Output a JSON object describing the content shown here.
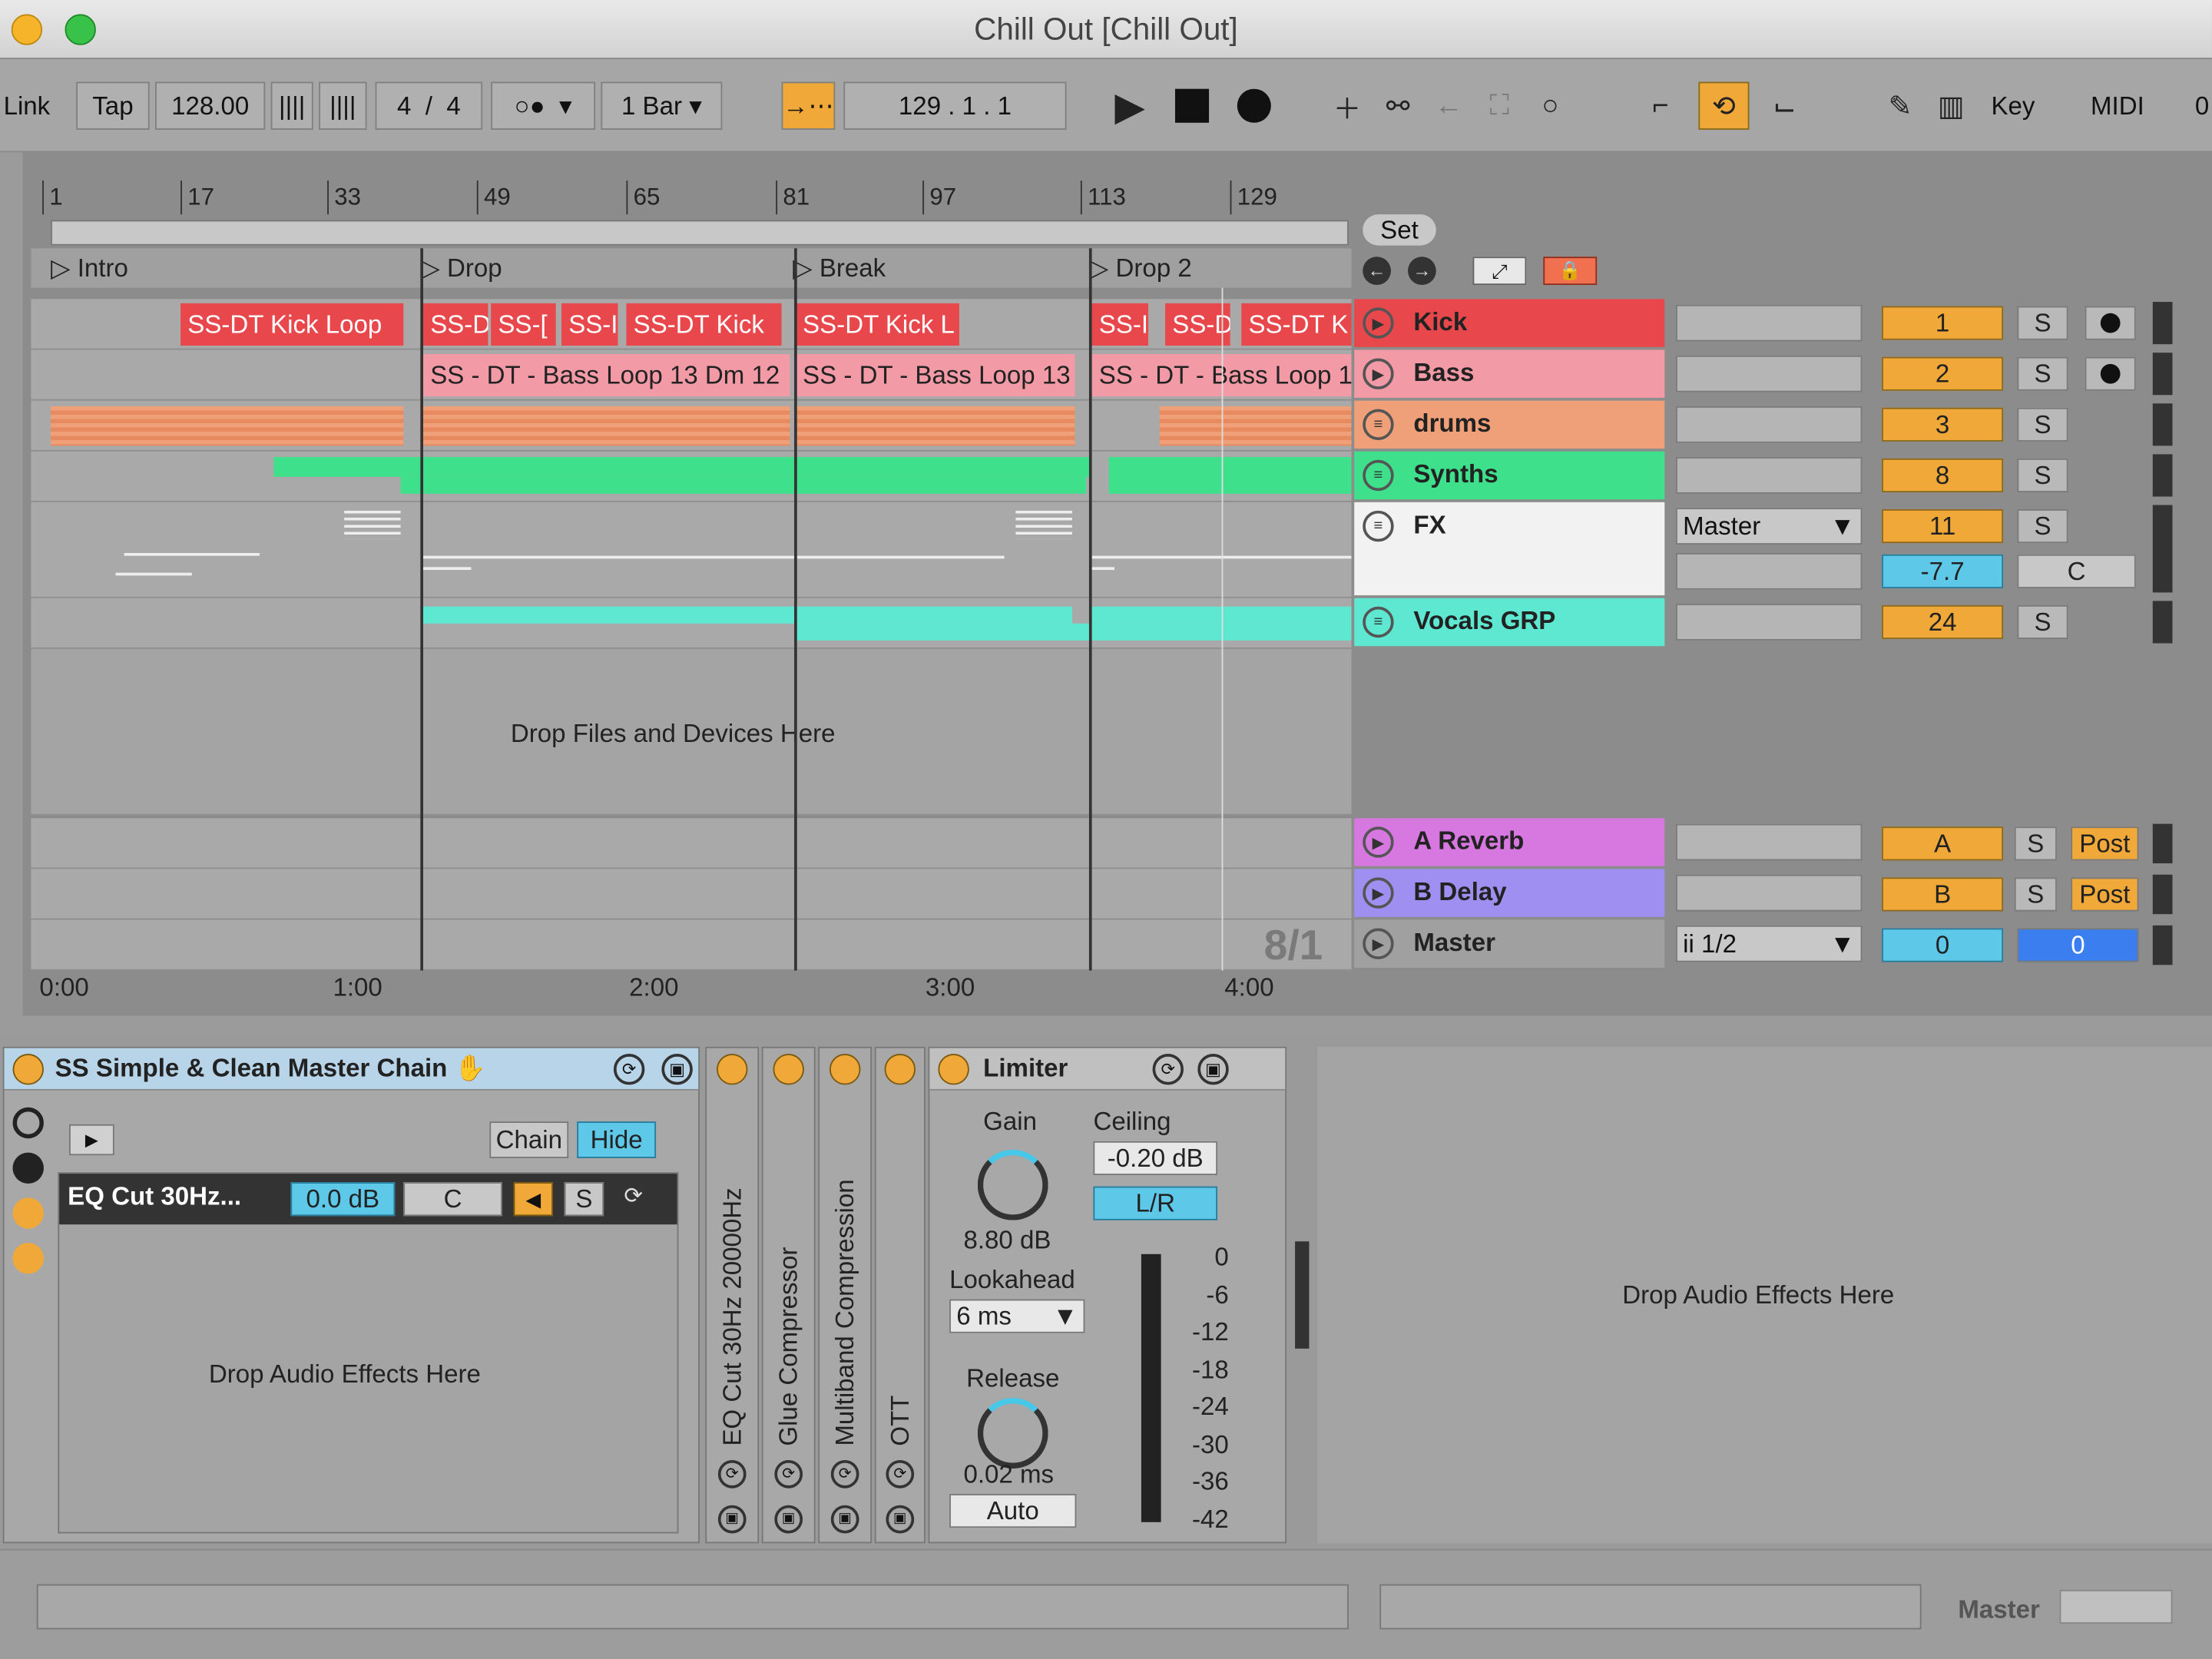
{
  "window": {
    "title": "Chill Out  [Chill Out]"
  },
  "control_bar": {
    "link": "Link",
    "tap": "Tap",
    "tempo": "128.00",
    "signature_num": "4",
    "signature_sep": "/",
    "signature_den": "4",
    "quantize": "1 Bar",
    "position": "129 .   1 .   1",
    "key": "Key",
    "midi": "MIDI",
    "cpu": "0"
  },
  "arrangement": {
    "ruler_bars": [
      "1",
      "17",
      "33",
      "49",
      "65",
      "81",
      "97",
      "113",
      "129"
    ],
    "set_label": "Set",
    "locators": [
      "Intro",
      "Drop",
      "Break",
      "Drop 2"
    ],
    "drop_hint": "Drop Files and Devices Here",
    "zoom_label": "8/1",
    "time_labels": [
      "0:00",
      "1:00",
      "2:00",
      "3:00",
      "4:00"
    ],
    "kick_clips": [
      "SS-DT Kick Loop",
      "SS-D",
      "SS-[",
      "SS-I",
      "SS-DT Kick",
      "SS-DT Kick L",
      "SS-I",
      "SS-D",
      "SS-DT K"
    ],
    "bass_clips": [
      "SS - DT - Bass Loop 13 Dm 12",
      "SS - DT - Bass Loop 13",
      "SS - DT - Bass Loop 1"
    ]
  },
  "tracks": [
    {
      "name": "Kick",
      "number": "1",
      "solo": "S",
      "color": "#e8474b"
    },
    {
      "name": "Bass",
      "number": "2",
      "solo": "S",
      "color": "#f29aa6"
    },
    {
      "name": "drums",
      "number": "3",
      "solo": "S",
      "color": "#f0a078"
    },
    {
      "name": "Synths",
      "number": "8",
      "solo": "S",
      "color": "#3fe08c"
    },
    {
      "name": "FX",
      "number": "11",
      "solo": "S",
      "routing": "Master",
      "volume": "-7.7",
      "pan": "C",
      "color": "#f2f2f2"
    },
    {
      "name": "Vocals GRP",
      "number": "24",
      "solo": "S",
      "color": "#5ee8d2"
    }
  ],
  "returns": [
    {
      "name": "A Reverb",
      "letter": "A",
      "solo": "S",
      "post": "Post",
      "color": "#d777e0"
    },
    {
      "name": "B Delay",
      "letter": "B",
      "solo": "S",
      "post": "Post",
      "color": "#9f8ff0"
    }
  ],
  "master": {
    "name": "Master",
    "routing": "ii 1/2",
    "volume": "0",
    "pan": "0"
  },
  "device_chain": {
    "rack_name": "SS Simple & Clean Master Chain",
    "chain_btn": "Chain",
    "hide_btn": "Hide",
    "chain_item": "EQ Cut 30Hz...",
    "chain_vol": "0.0 dB",
    "chain_pan": "C",
    "chain_solo": "S",
    "drop_hint": "Drop Audio Effects Here",
    "folded": [
      "EQ Cut 30Hz 20000Hz",
      "Glue Compressor",
      "Multiband Compression",
      "OTT"
    ],
    "limiter": {
      "name": "Limiter",
      "gain_label": "Gain",
      "gain": "8.80 dB",
      "ceiling_label": "Ceiling",
      "ceiling": "-0.20 dB",
      "lr": "L/R",
      "lookahead_label": "Lookahead",
      "lookahead": "6 ms",
      "release_label": "Release",
      "release": "0.02 ms",
      "auto": "Auto",
      "scale": [
        "0",
        "-6",
        "-12",
        "-18",
        "-24",
        "-30",
        "-36",
        "-42"
      ]
    },
    "right_drop": "Drop Audio Effects Here"
  },
  "status": {
    "master": "Master"
  }
}
